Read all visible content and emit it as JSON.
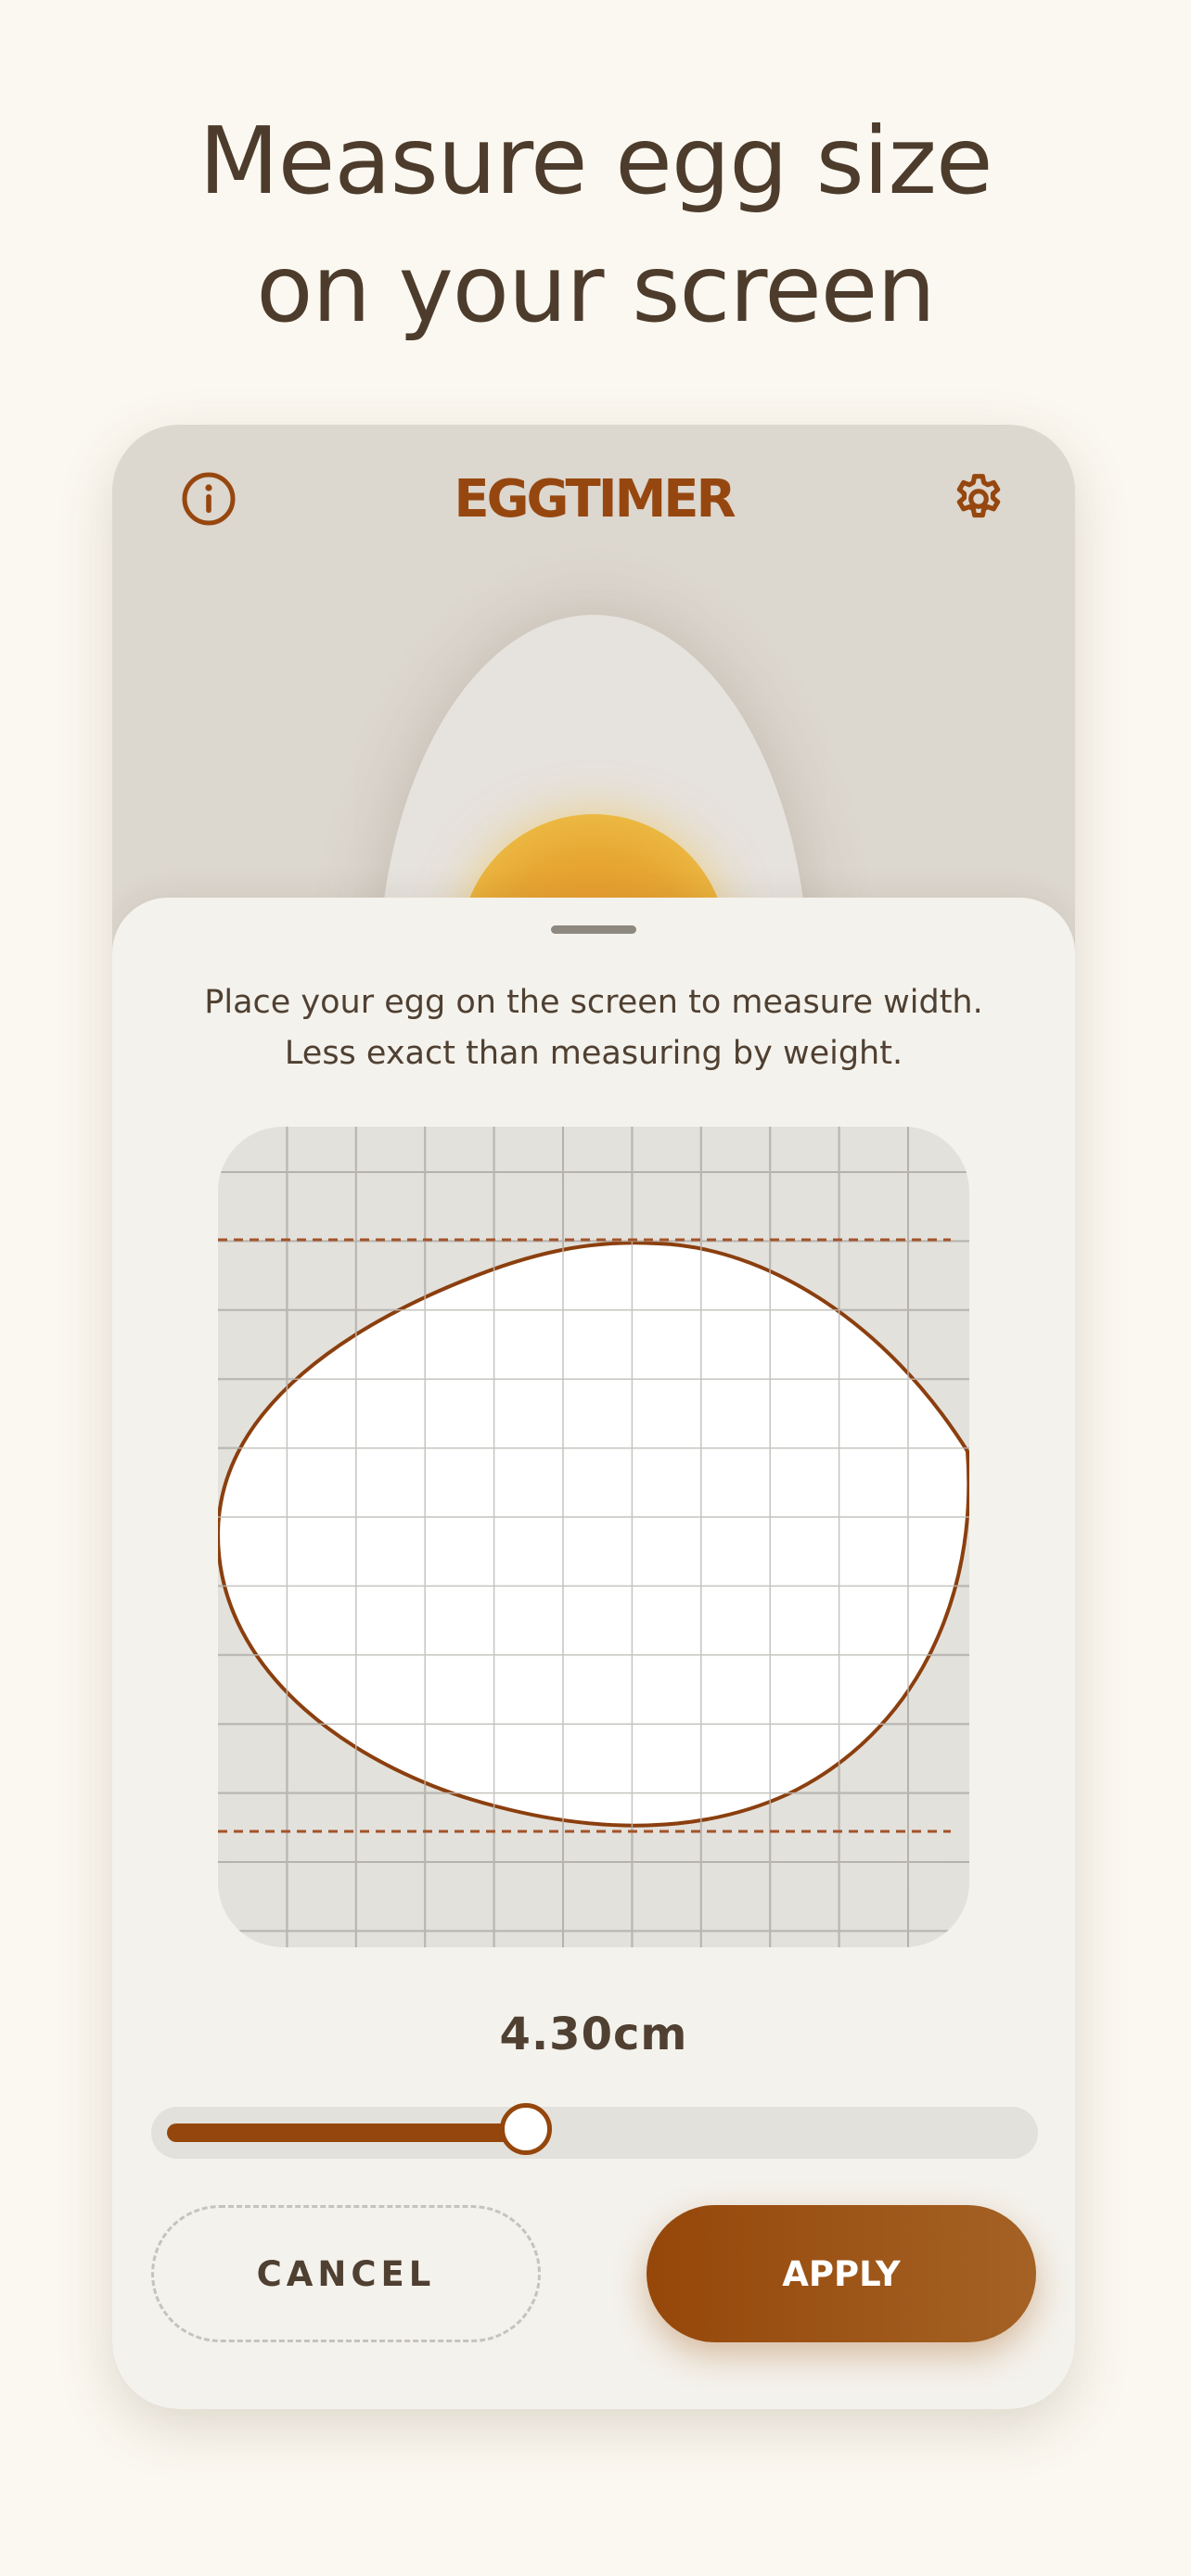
{
  "headline": {
    "line1": "Measure egg size",
    "line2": "on your screen"
  },
  "app": {
    "title": "EGGTIMER",
    "info_icon": "info-icon",
    "settings_icon": "gear-icon"
  },
  "sheet": {
    "instruction_line1": "Place your egg on the screen to measure width.",
    "instruction_line2": "Less exact than measuring by weight.",
    "measurement": "4.30cm",
    "slider_fraction": 0.42,
    "cancel_label": "CANCEL",
    "apply_label": "APPLY"
  },
  "colors": {
    "accent": "#96470f",
    "text": "#4d3c2c",
    "background": "#fbf8f1",
    "sheet": "#f4f2ec"
  }
}
